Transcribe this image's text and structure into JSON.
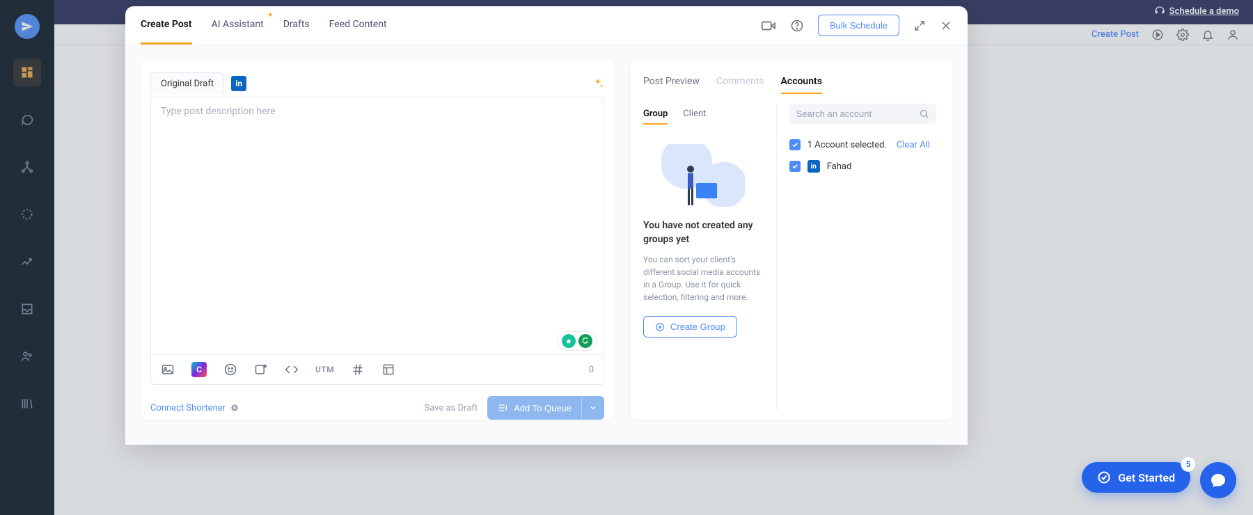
{
  "banner": {
    "schedule_demo": "Schedule a demo"
  },
  "header": {
    "create_post": "Create Post"
  },
  "modal": {
    "tabs": {
      "create_post": "Create Post",
      "ai_assistant": "AI Assistant",
      "drafts": "Drafts",
      "feed_content": "Feed Content"
    },
    "bulk_schedule": "Bulk Schedule",
    "editor": {
      "draft_tab": "Original Draft",
      "placeholder": "Type post description here",
      "char_count": "0",
      "utm": "UTM"
    },
    "below": {
      "connect_shortener": "Connect Shortener",
      "save_as_draft": "Save as Draft",
      "add_to_queue": "Add To Queue"
    },
    "right": {
      "tabs": {
        "post_preview": "Post Preview",
        "comments": "Comments",
        "accounts": "Accounts"
      },
      "sub_tabs": {
        "group": "Group",
        "client": "Client"
      },
      "empty": {
        "title": "You have not created any groups yet",
        "desc": "You can sort your client's different social media accounts in a Group. Use it for quick selection, filtering and more.",
        "create_group": "Create Group"
      },
      "search_placeholder": "Search an account",
      "selected_text": "1 Account selected.",
      "clear_all": "Clear All",
      "accounts": [
        {
          "name": "Fahad",
          "network": "linkedin"
        }
      ]
    }
  },
  "fab": {
    "get_started": "Get Started",
    "badge": "5"
  },
  "icons": {
    "linkedin": "in",
    "canva": "C"
  }
}
